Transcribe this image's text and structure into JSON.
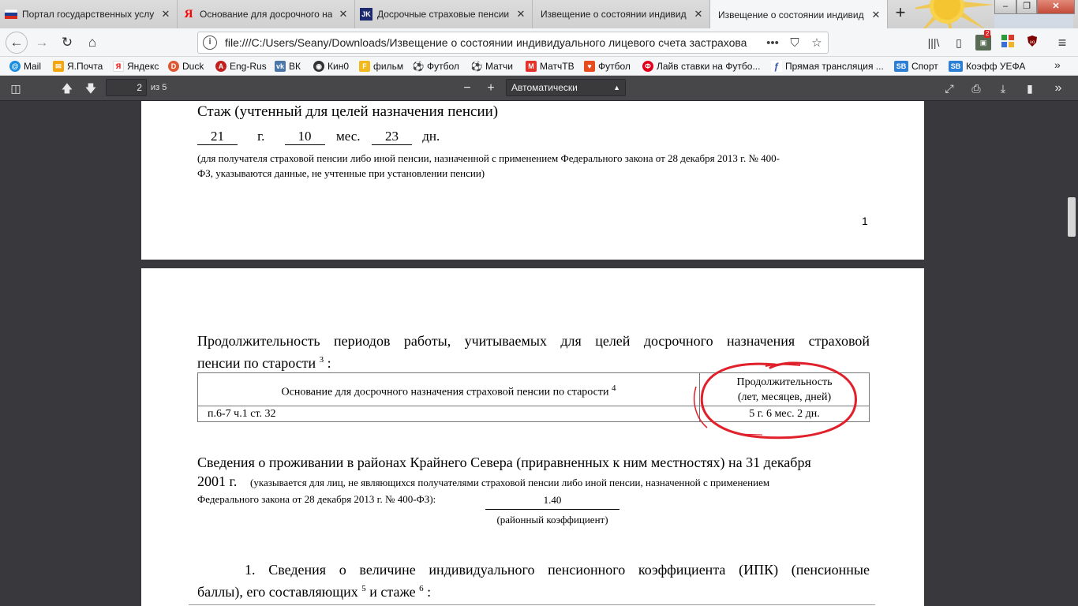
{
  "tabs": [
    {
      "title": "Портал государственных услу",
      "favicon": "russia-flag-icon",
      "active": false
    },
    {
      "title": "Основание для досрочного на",
      "favicon": "yandex-icon",
      "active": false
    },
    {
      "title": "Досрочные страховые пенсии",
      "favicon": "jk-icon",
      "active": false
    },
    {
      "title": "Извещение о состоянии индивид",
      "favicon": "none",
      "active": false
    },
    {
      "title": "Извещение о состоянии индивид",
      "favicon": "none",
      "active": true
    }
  ],
  "navbar": {
    "url": "file:///C:/Users/Seany/Downloads/Извещение о состоянии индивидуального лицевого счета застрахова",
    "notification_badge": "2"
  },
  "bookmarks": [
    {
      "label": "Mail",
      "icon": "mail-ru-icon",
      "color": "#168de2"
    },
    {
      "label": "Я.Почта",
      "icon": "yandex-mail-icon",
      "color": "#f4a60c"
    },
    {
      "label": "Яндекс",
      "icon": "yandex-icon",
      "color": "#ff0000"
    },
    {
      "label": "Duck",
      "icon": "duckduckgo-icon",
      "color": "#de5833"
    },
    {
      "label": "Eng-Rus",
      "icon": "translate-icon",
      "color": "#c21f1f"
    },
    {
      "label": "ВК",
      "icon": "vk-icon",
      "color": "#4a76a8"
    },
    {
      "label": "Кин0",
      "icon": "film-reel-icon",
      "color": "#333333"
    },
    {
      "label": "фильм",
      "icon": "f-icon",
      "color": "#f2b81c"
    },
    {
      "label": "Футбол",
      "icon": "football-icon",
      "color": "#444444"
    },
    {
      "label": "Матчи",
      "icon": "football-icon",
      "color": "#444444"
    },
    {
      "label": "МатчТВ",
      "icon": "match-tv-icon",
      "color": "#e4322b"
    },
    {
      "label": "Футбол",
      "icon": "shield-icon",
      "color": "#e84c1e"
    },
    {
      "label": "Лайв ставки на Футбо...",
      "icon": "bet-icon",
      "color": "#e0001b"
    },
    {
      "label": "Прямая трансляция ...",
      "icon": "stream-icon",
      "color": "#3355aa"
    },
    {
      "label": "Спорт",
      "icon": "sb-icon",
      "color": "#2b7fd6"
    },
    {
      "label": "Коэфф УЕФА",
      "icon": "sb-icon",
      "color": "#2b7fd6"
    }
  ],
  "pdf_toolbar": {
    "page_number": "2",
    "page_count": "из 5",
    "zoom": "Автоматически"
  },
  "page1": {
    "stazh_title": "Стаж (учтенный для целей назначения пенсии)",
    "years": "21",
    "years_unit": "г.",
    "months": "10",
    "months_unit": "мес.",
    "days": "23",
    "days_unit": "дн.",
    "note_line1": "(для получателя страховой пенсии либо иной пенсии, назначенной с применением Федерального закона от 28 декабря 2013 г. № 400-",
    "note_line2": "ФЗ, указываются данные, не учтенные при установлении пенсии)",
    "page_number": "1"
  },
  "page2": {
    "periods_title_line1": "Продолжительность периодов работы, учитываемых для целей досрочного назначения страховой",
    "periods_title_line2": "пенсии по старости",
    "periods_title_sup": "3",
    "periods_title_end": ":",
    "table": {
      "header_basis": "Основание для досрочного назначения страховой пенсии по старости",
      "header_basis_sup": "4",
      "header_duration_line1": "Продолжительность",
      "header_duration_line2": "(лет, месяцев, дней)",
      "rows": [
        {
          "basis": "п.6-7 ч.1 ст. 32",
          "duration": "5 г. 6 мес. 2 дн."
        }
      ]
    },
    "north_title_line1": "Сведения о проживании в районах Крайнего Севера (приравненных к ним местностях) на 31 декабря",
    "north_title_start": "2001 г.",
    "north_note_line1": "(указывается для лиц, не являющихся получателями страховой пенсии либо иной пенсии, назначенной с применением",
    "north_note_line2": "Федерального закона от 28 декабря 2013 г. № 400-ФЗ):",
    "coefficient_value": "1.40",
    "coefficient_label": "(районный коэффициент)",
    "ipk_line1": "1. Сведения о величине индивидуального пенсионного коэффициента (ИПК) (пенсионные",
    "ipk_line2": "баллы), его составляющих",
    "ipk_sup1": "5",
    "ipk_mid": "и стаже",
    "ipk_sup2": "6",
    "ipk_end": ":"
  },
  "colors": {
    "annotation": "#e0202a",
    "pdf_toolbar": "#474749",
    "viewer_bg": "#38383d"
  }
}
